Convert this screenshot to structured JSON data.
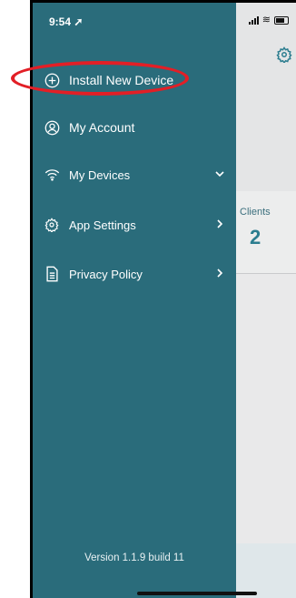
{
  "status_bar": {
    "time": "9:54"
  },
  "menu": {
    "items": [
      {
        "label": "Install New Device",
        "icon": "plus-circle-icon"
      },
      {
        "label": "My Account",
        "icon": "account-icon"
      },
      {
        "label": "My Devices",
        "icon": "wifi-icon",
        "chevron": "chevron-down-icon"
      },
      {
        "label": "App Settings",
        "icon": "gear-icon",
        "chevron": "chevron-right-icon"
      },
      {
        "label": "Privacy Policy",
        "icon": "document-icon",
        "chevron": "chevron-right-icon"
      }
    ]
  },
  "version": "Version 1.1.9 build 11",
  "background_app": {
    "clients_label": "Clients",
    "clients_count": "2"
  },
  "colors": {
    "drawer": "#2a6c7b",
    "accent": "#2b7d8f",
    "highlight": "#e21f26"
  }
}
